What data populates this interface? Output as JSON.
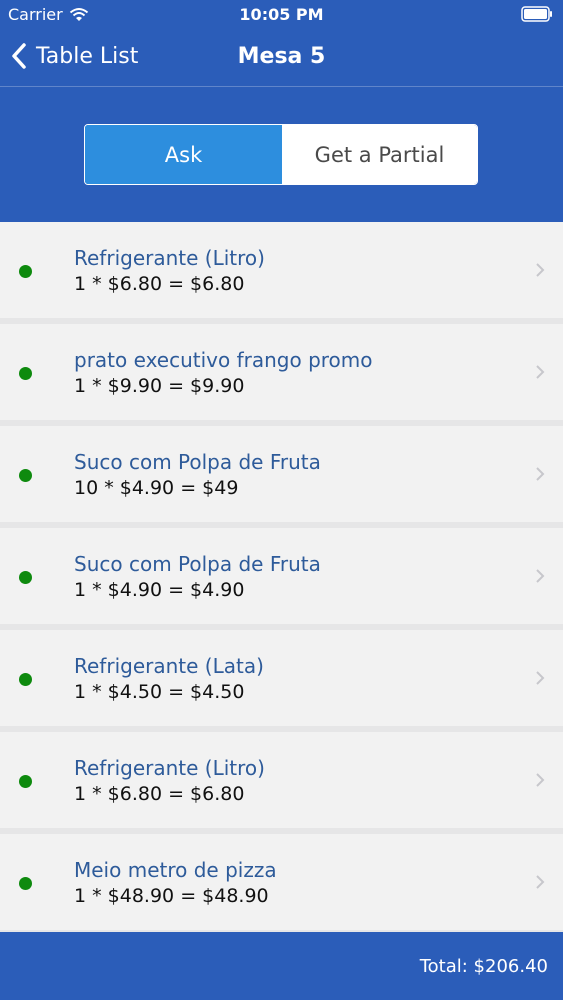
{
  "status_bar": {
    "carrier": "Carrier",
    "time": "10:05 PM"
  },
  "nav": {
    "back_label": "Table List",
    "title": "Mesa 5"
  },
  "segmented": {
    "options": [
      "Ask",
      "Get a Partial"
    ],
    "selected": "Ask"
  },
  "items": [
    {
      "name": "Refrigerante (Litro)",
      "detail": "1 * $6.80 = $6.80",
      "status_color": "#0e8a0e"
    },
    {
      "name": "prato executivo frango promo",
      "detail": "1 * $9.90 = $9.90",
      "status_color": "#0e8a0e"
    },
    {
      "name": "Suco com Polpa de Fruta",
      "detail": "10 * $4.90 = $49",
      "status_color": "#0e8a0e"
    },
    {
      "name": "Suco com Polpa de Fruta",
      "detail": "1 * $4.90 = $4.90",
      "status_color": "#0e8a0e"
    },
    {
      "name": "Refrigerante (Lata)",
      "detail": "1 * $4.50 = $4.50",
      "status_color": "#0e8a0e"
    },
    {
      "name": "Refrigerante (Litro)",
      "detail": "1 * $6.80 = $6.80",
      "status_color": "#0e8a0e"
    },
    {
      "name": "Meio metro de pizza",
      "detail": "1 * $48.90 = $48.90",
      "status_color": "#0e8a0e"
    }
  ],
  "footer": {
    "total": "Total: $206.40"
  },
  "colors": {
    "brand": "#2b5db9",
    "segment_active": "#2d8ede",
    "item_name": "#2e5b9a",
    "status_dot": "#0e8a0e"
  },
  "icons": {
    "wifi": "wifi-icon",
    "battery": "battery-icon",
    "back": "back-chevron-icon",
    "status": "dot-icon",
    "disclosure": "chevron-right-icon"
  }
}
